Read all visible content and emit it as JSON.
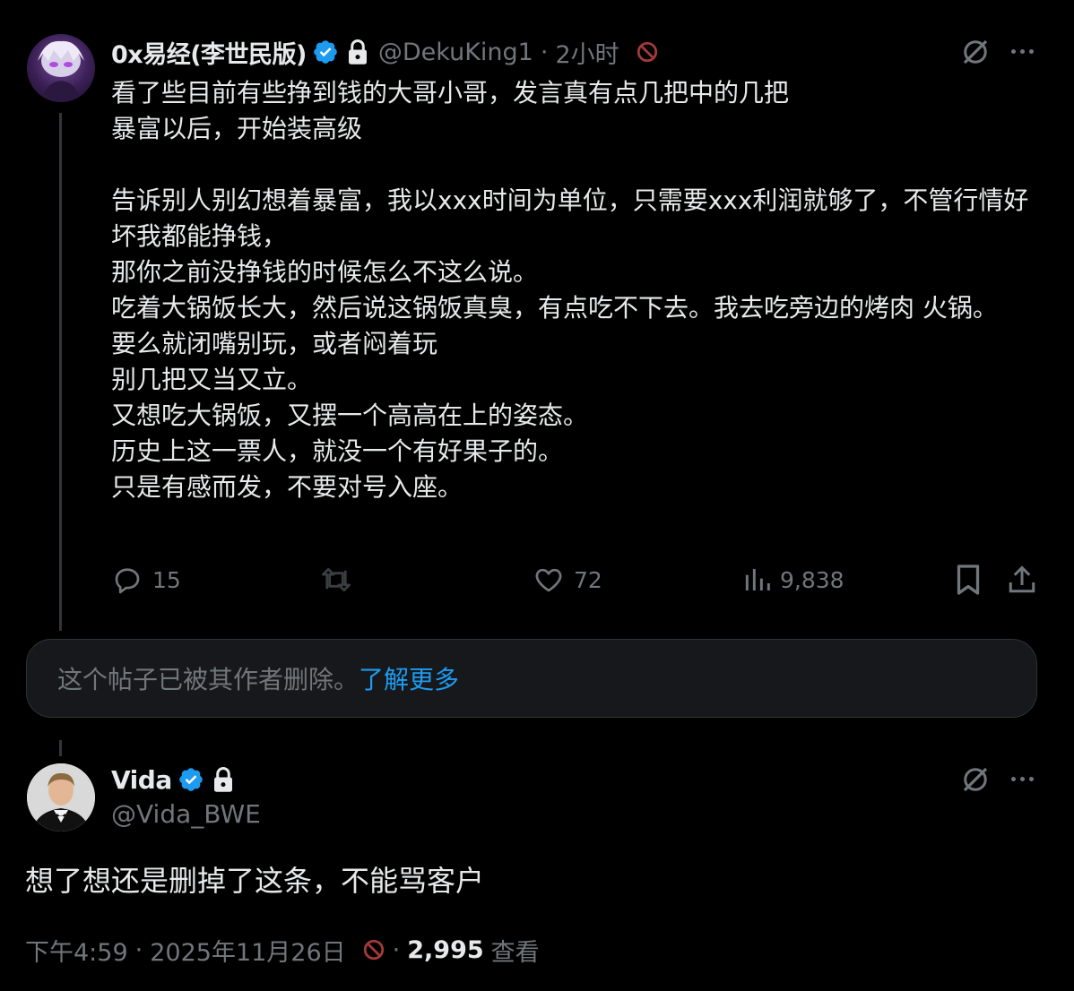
{
  "tweet1": {
    "display_name": "0x易经(李世民版)",
    "handle": "@DekuKing1",
    "separator": "·",
    "time": "2小时",
    "body": "看了些目前有些挣到钱的大哥小哥，发言真有点几把中的几把\n暴富以后，开始装高级\n\n告诉别人别幻想着暴富，我以xxx时间为单位，只需要xxx利润就够了，不管行情好坏我都能挣钱，\n那你之前没挣钱的时候怎么不这么说。\n吃着大锅饭长大，然后说这锅饭真臭，有点吃不下去。我去吃旁边的烤肉 火锅。\n要么就闭嘴别玩，或者闷着玩\n别几把又当又立。\n又想吃大锅饭，又摆一个高高在上的姿态。\n历史上这一票人，就没一个有好果子的。\n只是有感而发，不要对号入座。",
    "replies": "15",
    "retweets": "",
    "likes": "72",
    "views": "9,838"
  },
  "deleted_notice": {
    "text": "这个帖子已被其作者删除。",
    "link": "了解更多"
  },
  "tweet2": {
    "display_name": "Vida",
    "handle": "@Vida_BWE",
    "body": "想了想还是删掉了这条，不能骂客户",
    "time": "下午4:59",
    "separator": "·",
    "date": "2025年11月26日",
    "separator2": "·",
    "views_count": "2,995",
    "views_label": "查看"
  },
  "colors": {
    "background": "#000000",
    "text": "#e7e9ea",
    "muted": "#71767b",
    "accent": "#1d9bf0",
    "blocked": "#f4212e"
  },
  "icons": [
    "verified-badge-icon",
    "lock-icon",
    "blocked-icon",
    "grok-icon",
    "more-icon",
    "reply-icon",
    "retweet-icon",
    "like-icon",
    "views-icon",
    "bookmark-icon",
    "share-icon"
  ]
}
